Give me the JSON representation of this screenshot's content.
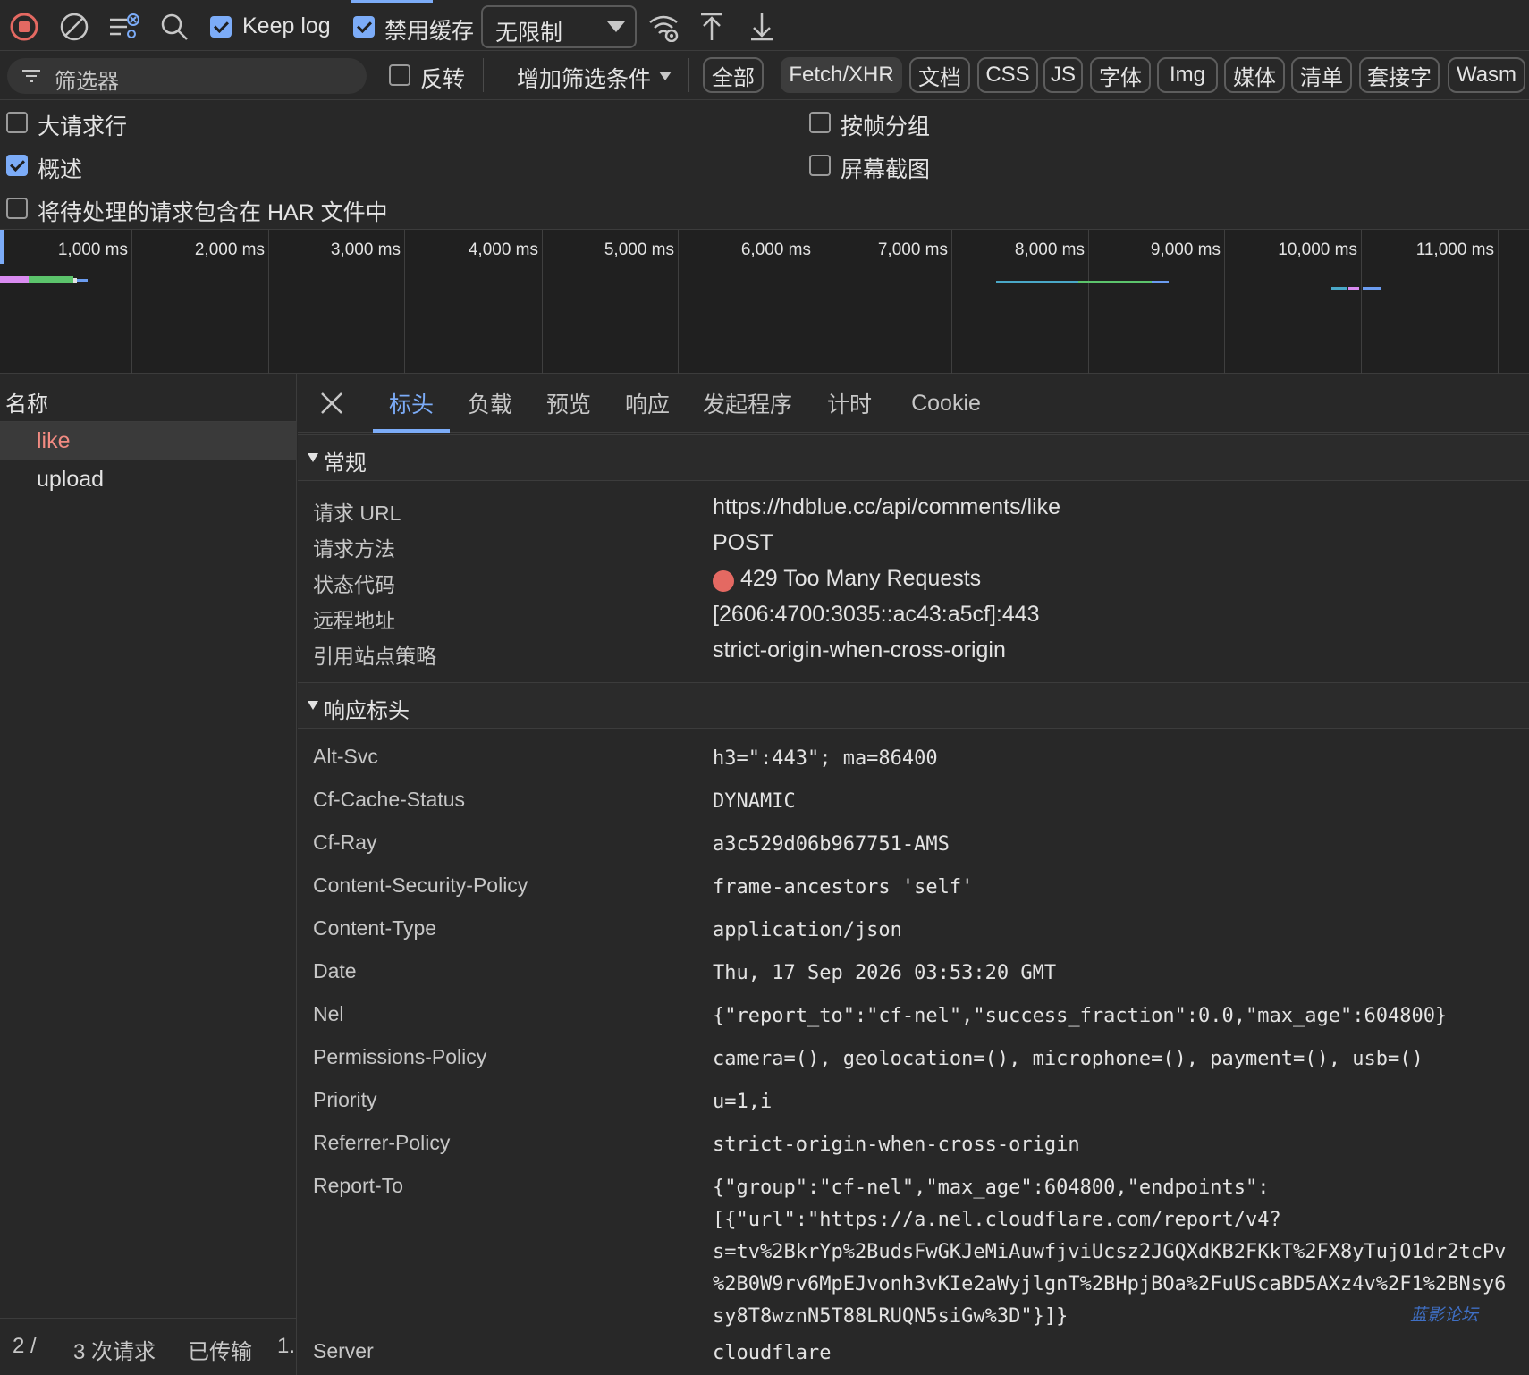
{
  "toolbar": {
    "keep_log_label": "Keep log",
    "disable_cache_label": "禁用缓存",
    "throttle_value": "无限制"
  },
  "filter": {
    "placeholder": "筛选器",
    "invert_label": "反转",
    "more_filters_label": "增加筛选条件",
    "types": [
      "全部",
      "Fetch/XHR",
      "文档",
      "CSS",
      "JS",
      "字体",
      "Img",
      "媒体",
      "清单",
      "套接字",
      "Wasm"
    ],
    "selected_type": "Fetch/XHR"
  },
  "options": {
    "big_rows": {
      "label": "大请求行",
      "checked": false
    },
    "overview": {
      "label": "概述",
      "checked": true
    },
    "include_pending_har": {
      "label": "将待处理的请求包含在 HAR 文件中",
      "checked": false
    },
    "group_by_frame": {
      "label": "按帧分组",
      "checked": false
    },
    "screenshots": {
      "label": "屏幕截图",
      "checked": false
    }
  },
  "timeline": {
    "ticks": [
      "1,000 ms",
      "2,000 ms",
      "3,000 ms",
      "4,000 ms",
      "5,000 ms",
      "6,000 ms",
      "7,000 ms",
      "8,000 ms",
      "9,000 ms",
      "10,000 ms",
      "11,000 ms"
    ]
  },
  "requests": {
    "column_header": "名称",
    "items": [
      "like",
      "upload"
    ],
    "selected": "like"
  },
  "status": {
    "filtered": "2 /",
    "requests": "3 次请求",
    "transferred": "已传输",
    "size_partial": "1."
  },
  "detail": {
    "tabs": [
      "标头",
      "负载",
      "预览",
      "响应",
      "发起程序",
      "计时",
      "Cookie"
    ],
    "active_tab": "标头",
    "general": {
      "title": "常规",
      "rows": [
        {
          "key": "请求 URL",
          "value": "https://hdblue.cc/api/comments/like"
        },
        {
          "key": "请求方法",
          "value": "POST"
        },
        {
          "key": "状态代码",
          "value": "429 Too Many Requests"
        },
        {
          "key": "远程地址",
          "value": "[2606:4700:3035::ac43:a5cf]:443"
        },
        {
          "key": "引用站点策略",
          "value": "strict-origin-when-cross-origin"
        }
      ],
      "status_color": "#e46962"
    },
    "response_headers": {
      "title": "响应标头",
      "rows": [
        {
          "key": "Alt-Svc",
          "value": "h3=\":443\"; ma=86400"
        },
        {
          "key": "Cf-Cache-Status",
          "value": "DYNAMIC"
        },
        {
          "key": "Cf-Ray",
          "value": "a3c529d06b967751-AMS"
        },
        {
          "key": "Content-Security-Policy",
          "value": "frame-ancestors 'self'"
        },
        {
          "key": "Content-Type",
          "value": "application/json"
        },
        {
          "key": "Date",
          "value": "Thu, 17 Sep 2026 03:53:20 GMT"
        },
        {
          "key": "Nel",
          "value": "{\"report_to\":\"cf-nel\",\"success_fraction\":0.0,\"max_age\":604800}"
        },
        {
          "key": "Permissions-Policy",
          "value": "camera=(), geolocation=(), microphone=(), payment=(), usb=()"
        },
        {
          "key": "Priority",
          "value": "u=1,i"
        },
        {
          "key": "Referrer-Policy",
          "value": "strict-origin-when-cross-origin"
        },
        {
          "key": "Report-To",
          "value_lines": [
            "{\"group\":\"cf-nel\",\"max_age\":604800,\"endpoints\":",
            "[{\"url\":\"https://a.nel.cloudflare.com/report/v4?",
            "s=tv%2BkrYp%2BudsFwGKJeMiAuwfjviUcsz2JGQXdKB2FKkT%2FX8yTujO1dr2tcPv",
            "%2B0W9rv6MpEJvonh3vKIe2aWyjlgnT%2BHpjBOa%2FuUScaBD5AXz4v%2F1%2BNsy6",
            "sy8T8wznN5T88LRUQN5siGw%3D\"}]}"
          ]
        },
        {
          "key": "Server",
          "value": "cloudflare"
        }
      ]
    },
    "watermark": "蓝影论坛"
  },
  "colors": {
    "accent": "#7cacf8",
    "record_red": "#e46962"
  }
}
